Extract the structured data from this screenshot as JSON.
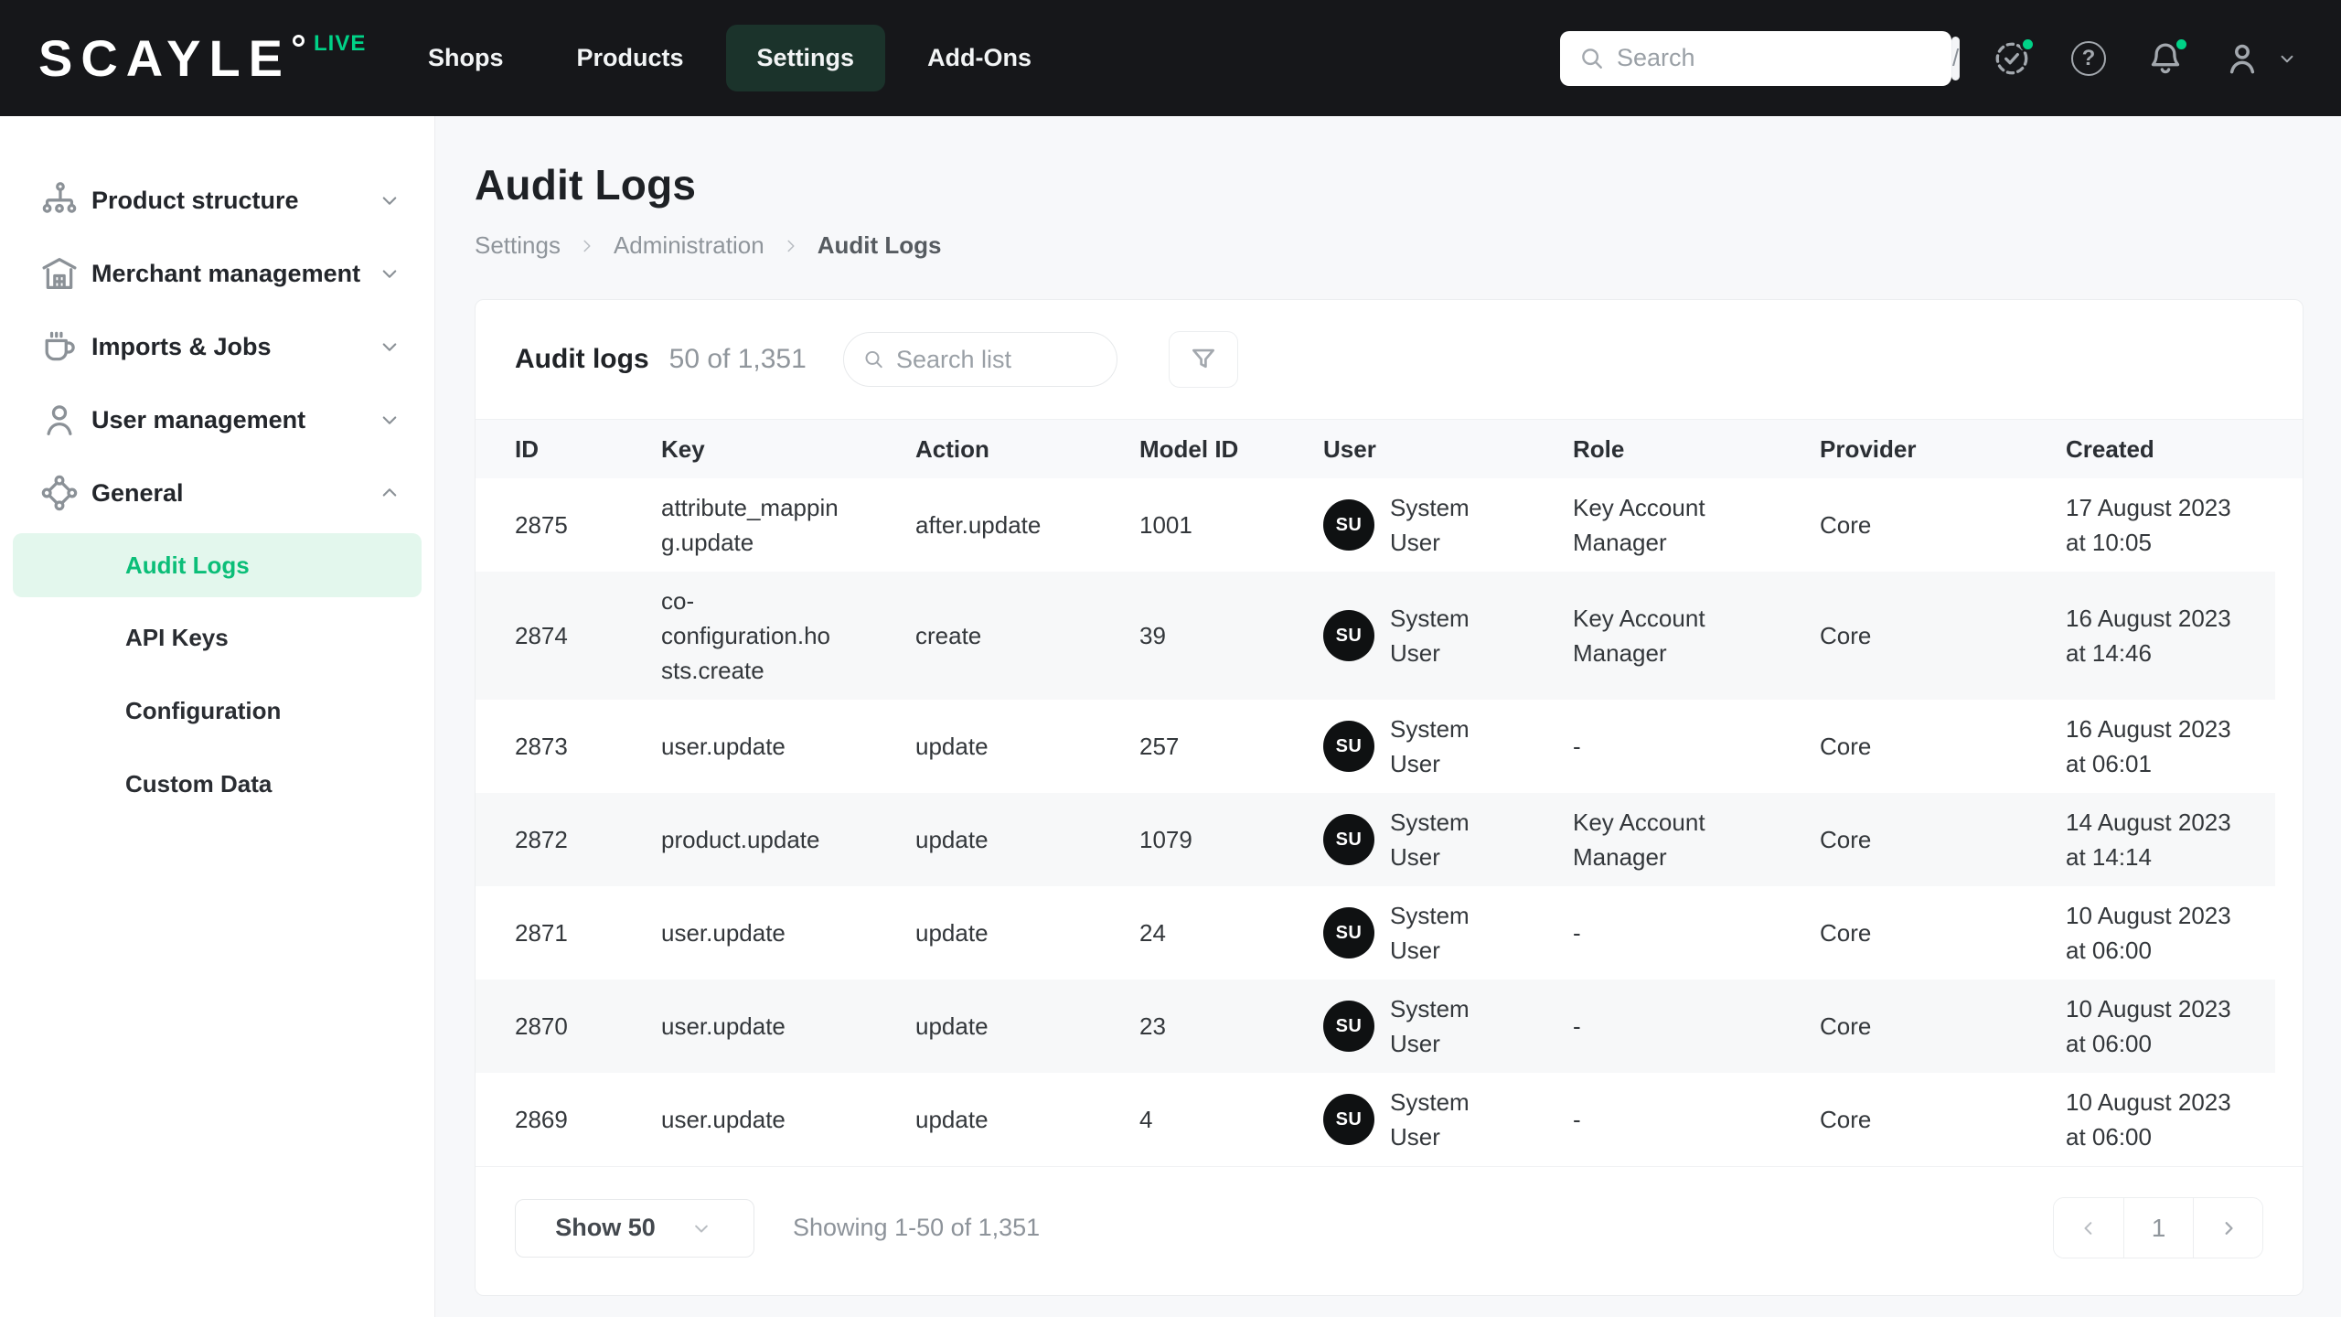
{
  "topbar": {
    "logo_text": "SCAYLE",
    "logo_badge": "LIVE",
    "nav": [
      {
        "label": "Shops",
        "active": false
      },
      {
        "label": "Products",
        "active": false
      },
      {
        "label": "Settings",
        "active": true
      },
      {
        "label": "Add-Ons",
        "active": false
      }
    ],
    "search": {
      "placeholder": "Search",
      "shortcut_key": "/"
    },
    "help_glyph": "?"
  },
  "sidebar": {
    "items": [
      {
        "label": "Product structure",
        "icon": "hierarchy-icon",
        "expanded": false
      },
      {
        "label": "Merchant management",
        "icon": "store-icon",
        "expanded": false
      },
      {
        "label": "Imports & Jobs",
        "icon": "mug-icon",
        "expanded": false
      },
      {
        "label": "User management",
        "icon": "user-icon",
        "expanded": false
      },
      {
        "label": "General",
        "icon": "nodes-icon",
        "expanded": true,
        "children": [
          {
            "label": "Audit Logs",
            "active": true
          },
          {
            "label": "API Keys",
            "active": false
          },
          {
            "label": "Configuration",
            "active": false
          },
          {
            "label": "Custom Data",
            "active": false
          }
        ]
      }
    ]
  },
  "page": {
    "title": "Audit Logs",
    "breadcrumb": [
      "Settings",
      "Administration",
      "Audit Logs"
    ]
  },
  "card": {
    "header": {
      "title": "Audit logs",
      "count": "50 of 1,351",
      "search_placeholder": "Search list"
    },
    "table": {
      "columns": [
        "ID",
        "Key",
        "Action",
        "Model ID",
        "User",
        "Role",
        "Provider",
        "Created"
      ],
      "rows": [
        {
          "id": "2875",
          "key": "attribute_mapping.update",
          "action": "after.update",
          "model_id": "1001",
          "user_initials": "SU",
          "user": "System User",
          "role": "Key Account Manager",
          "provider": "Core",
          "created": "17 August 2023 at 10:05"
        },
        {
          "id": "2874",
          "key": "co-configuration.hosts.create",
          "action": "create",
          "model_id": "39",
          "user_initials": "SU",
          "user": "System User",
          "role": "Key Account Manager",
          "provider": "Core",
          "created": "16 August 2023 at 14:46"
        },
        {
          "id": "2873",
          "key": "user.update",
          "action": "update",
          "model_id": "257",
          "user_initials": "SU",
          "user": "System User",
          "role": "-",
          "provider": "Core",
          "created": "16 August 2023 at 06:01"
        },
        {
          "id": "2872",
          "key": "product.update",
          "action": "update",
          "model_id": "1079",
          "user_initials": "SU",
          "user": "System User",
          "role": "Key Account Manager",
          "provider": "Core",
          "created": "14 August 2023 at 14:14"
        },
        {
          "id": "2871",
          "key": "user.update",
          "action": "update",
          "model_id": "24",
          "user_initials": "SU",
          "user": "System User",
          "role": "-",
          "provider": "Core",
          "created": "10 August 2023 at 06:00"
        },
        {
          "id": "2870",
          "key": "user.update",
          "action": "update",
          "model_id": "23",
          "user_initials": "SU",
          "user": "System User",
          "role": "-",
          "provider": "Core",
          "created": "10 August 2023 at 06:00"
        },
        {
          "id": "2869",
          "key": "user.update",
          "action": "update",
          "model_id": "4",
          "user_initials": "SU",
          "user": "System User",
          "role": "-",
          "provider": "Core",
          "created": "10 August 2023 at 06:00"
        }
      ]
    },
    "footer": {
      "page_size_label": "Show 50",
      "showing": "Showing 1-50 of 1,351",
      "page": "1"
    }
  },
  "colors": {
    "brand_green": "#00D287",
    "topbar_bg": "#16171A",
    "nav_active_bg": "#1B332B",
    "sidebar_active_bg": "#E3F7ED",
    "sidebar_active_text": "#0BBE78",
    "avatar_bg": "#0F1112",
    "zebra_row": "#F7F8F9",
    "table_header_bg": "#F8F9FB",
    "page_bg": "#F7F8FA"
  }
}
